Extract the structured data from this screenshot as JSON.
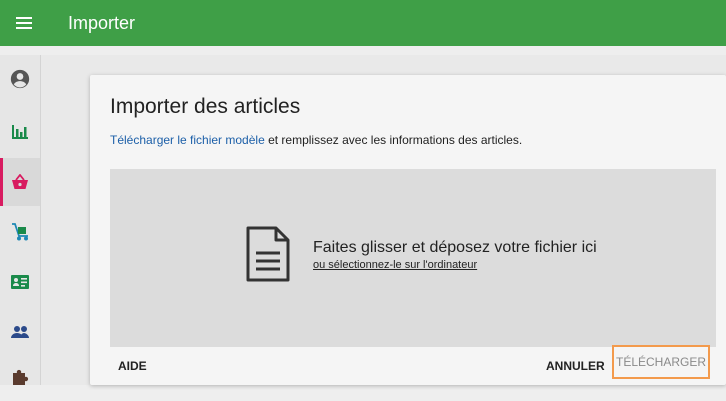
{
  "app": {
    "title": "Importer"
  },
  "sidebar": {
    "items": [
      {
        "icon": "account-circle-icon"
      },
      {
        "icon": "bar-chart-icon"
      },
      {
        "icon": "basket-icon",
        "active": true
      },
      {
        "icon": "hand-truck-icon"
      },
      {
        "icon": "id-card-icon"
      },
      {
        "icon": "people-icon"
      },
      {
        "icon": "puzzle-icon"
      }
    ],
    "accent_color": "#d81b60"
  },
  "card": {
    "title": "Importer des articles",
    "template_link": "Télécharger le fichier modèle",
    "description_rest": " et remplissez avec les informations des articles."
  },
  "dropzone": {
    "title": "Faites glisser et déposez votre fichier ici",
    "browse_link": "ou sélectionnez-le sur l'ordinateur"
  },
  "actions": {
    "help": "AIDE",
    "cancel": "ANNULER",
    "upload": "TÉLÉCHARGER"
  },
  "colors": {
    "header": "#3f9f47",
    "highlight": "#f39a4c",
    "link": "#1c5fa8"
  }
}
